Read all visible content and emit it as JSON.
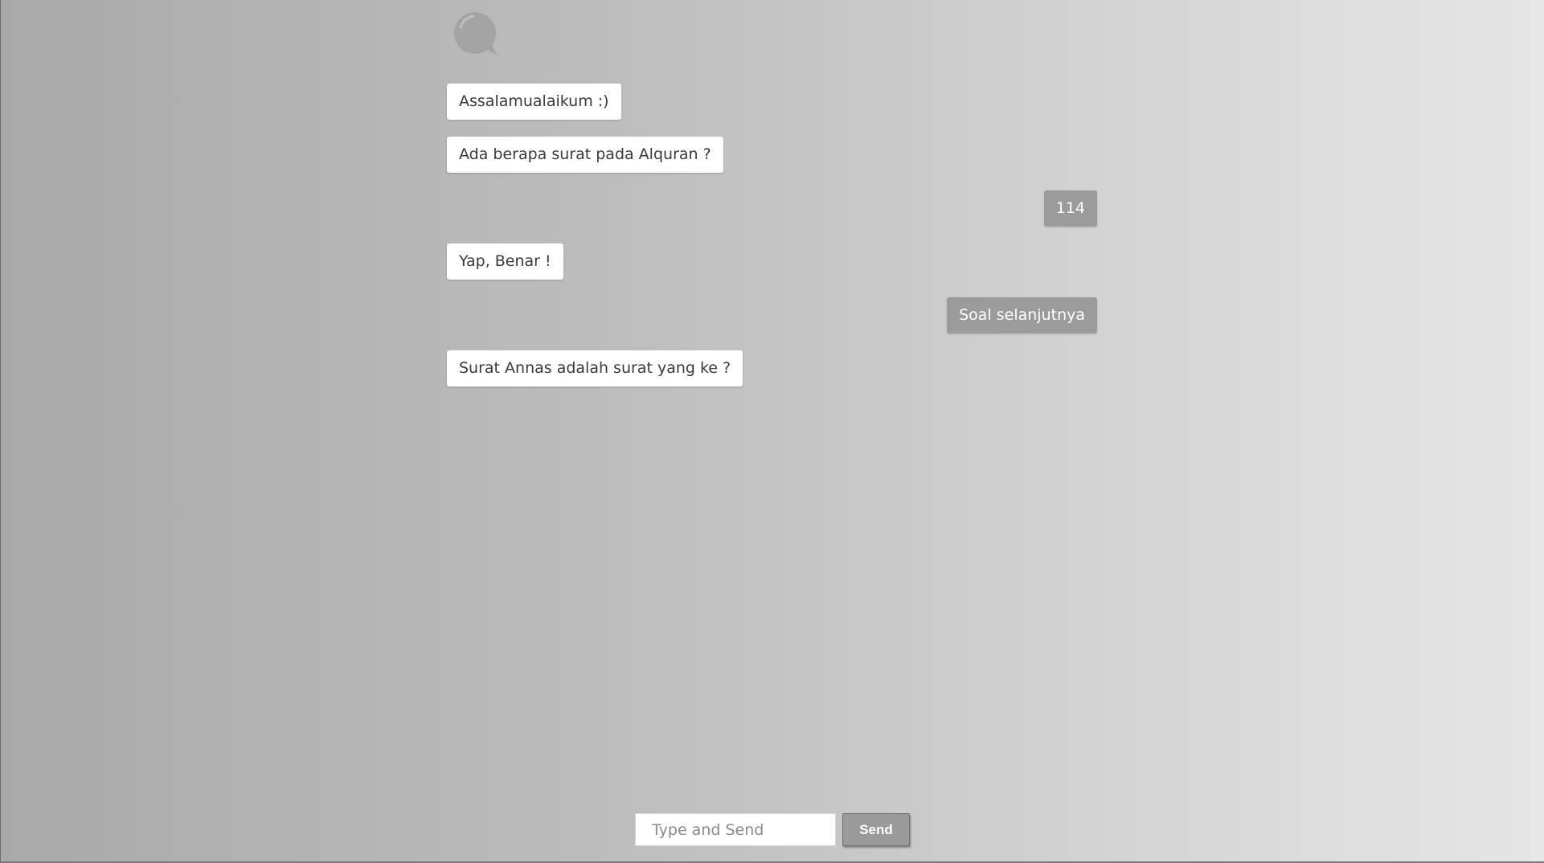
{
  "header": {
    "icon": "chat-bubble-icon"
  },
  "messages": [
    {
      "sender": "bot",
      "text": "Assalamualaikum :)"
    },
    {
      "sender": "bot",
      "text": "Ada berapa surat pada Alquran ?"
    },
    {
      "sender": "user",
      "text": "114"
    },
    {
      "sender": "bot",
      "text": "Yap,  Benar !"
    },
    {
      "sender": "user",
      "text": "Soal selanjutnya"
    },
    {
      "sender": "bot",
      "text": "Surat Annas adalah surat yang ke ?"
    }
  ],
  "composer": {
    "placeholder": "Type and Send",
    "value": "",
    "send_label": "Send"
  },
  "colors": {
    "bot_bubble": "#ffffff",
    "user_bubble": "#9b9b9b",
    "send_button": "#9a9a9a"
  }
}
